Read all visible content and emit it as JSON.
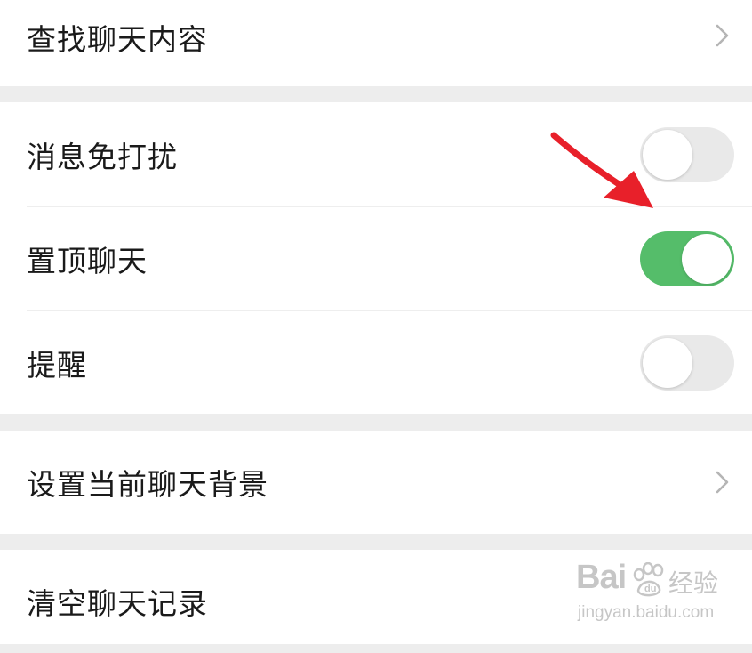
{
  "settings": {
    "search_chat": {
      "label": "查找聊天内容"
    },
    "mute": {
      "label": "消息免打扰",
      "enabled": false
    },
    "sticky": {
      "label": "置顶聊天",
      "enabled": true
    },
    "remind": {
      "label": "提醒",
      "enabled": false
    },
    "background": {
      "label": "设置当前聊天背景"
    },
    "clear": {
      "label": "清空聊天记录"
    }
  },
  "colors": {
    "toggle_on": "#55bd6a",
    "toggle_off": "#e9e9e9",
    "arrow": "#e8202a",
    "page_bg": "#ededed"
  },
  "watermark": {
    "brand": "Bai",
    "suffix": "经验",
    "url": "jingyan.baidu.com"
  }
}
